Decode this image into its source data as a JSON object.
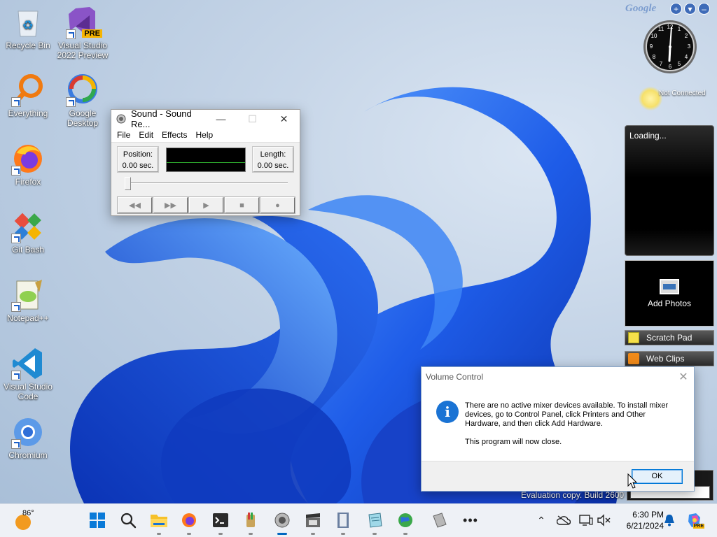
{
  "desktop": {
    "icons": [
      {
        "label": "Recycle Bin"
      },
      {
        "label": "Visual Studio 2022 Preview",
        "badge": "PRE"
      },
      {
        "label": "Everything"
      },
      {
        "label": "Google Desktop"
      },
      {
        "label": "Firefox"
      },
      {
        "label": "Git Bash"
      },
      {
        "label": "Notepad++"
      },
      {
        "label": "Visual Studio Code"
      },
      {
        "label": "Chromium"
      }
    ],
    "eval_text": "Evaluation copy. Build 2600"
  },
  "sound_recorder": {
    "title": "Sound - Sound Re...",
    "menu": [
      "File",
      "Edit",
      "Effects",
      "Help"
    ],
    "position_label": "Position:",
    "position_value": "0.00 sec.",
    "length_label": "Length:",
    "length_value": "0.00 sec.",
    "controls": [
      "rewind-icon",
      "fast-forward-icon",
      "play-icon",
      "stop-icon",
      "record-icon"
    ]
  },
  "volume_dialog": {
    "title": "Volume Control",
    "message": "There are no active mixer devices available. To install mixer devices, go to Control Panel, click Printers and Other Hardware, and then click Add Hardware.",
    "message2": "This program will now close.",
    "ok_label": "OK"
  },
  "sidebar": {
    "logo": "Google",
    "network_status": "Not Connected",
    "loading_text": "Loading...",
    "photos_label": "Add Photos",
    "scratch_pad": "Scratch Pad",
    "web_clips": "Web Clips"
  },
  "taskbar": {
    "weather_temp": "86°",
    "time": "6:30 PM",
    "date": "6/21/2024",
    "pinned": [
      "start-icon",
      "search-icon",
      "file-explorer-icon",
      "firefox-icon",
      "terminal-icon",
      "paint-icon",
      "sound-recorder-icon",
      "movie-maker-icon",
      "notebook-icon",
      "notepad-icon",
      "network-globe-icon",
      "archive-icon",
      "more-icon"
    ],
    "tray": [
      "chevron-up-icon",
      "onedrive-icon",
      "display-icon",
      "volume-muted-icon",
      "notification-bell-icon",
      "copilot-icon"
    ],
    "copilot_badge": "PRE"
  },
  "colors": {
    "accent": "#0067c0",
    "wallpaper_blue": "#1a4fd8"
  }
}
